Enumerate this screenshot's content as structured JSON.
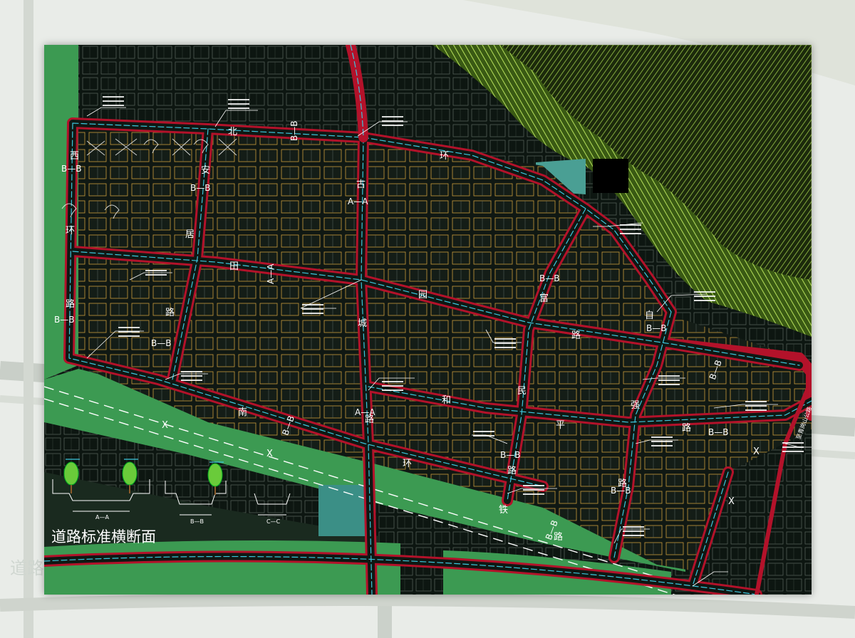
{
  "map": {
    "title": "道路标准横断面",
    "ghost_title": "道路",
    "side_road_label": "至青岗山公路",
    "x_marks": [
      "X",
      "X",
      "X",
      "X"
    ],
    "roads": [
      {
        "id": "ring-north-1",
        "text": "北"
      },
      {
        "id": "ring-north-2",
        "text": "环"
      },
      {
        "id": "ring-west-1",
        "text": "西"
      },
      {
        "id": "ring-west-2",
        "text": "环"
      },
      {
        "id": "ring-west-3",
        "text": "路"
      },
      {
        "id": "anju-1",
        "text": "安"
      },
      {
        "id": "anju-2",
        "text": "居"
      },
      {
        "id": "anju-3",
        "text": "路"
      },
      {
        "id": "gucheng-1",
        "text": "古"
      },
      {
        "id": "gucheng-2",
        "text": "城"
      },
      {
        "id": "gucheng-3",
        "text": "路"
      },
      {
        "id": "tianyuan-1",
        "text": "田"
      },
      {
        "id": "tianyuan-2",
        "text": "园"
      },
      {
        "id": "tianyuan-3",
        "text": "路"
      },
      {
        "id": "fuming-1",
        "text": "富"
      },
      {
        "id": "fuming-2",
        "text": "民"
      },
      {
        "id": "fuming-3",
        "text": "路"
      },
      {
        "id": "ziqiang-1",
        "text": "自"
      },
      {
        "id": "ziqiang-2",
        "text": "强"
      },
      {
        "id": "ziqiang-3",
        "text": "路"
      },
      {
        "id": "ring-south-1",
        "text": "南"
      },
      {
        "id": "ring-south-2",
        "text": "环"
      },
      {
        "id": "railway-1",
        "text": "铁"
      },
      {
        "id": "railway-2",
        "text": "路"
      },
      {
        "id": "heping-1",
        "text": "和"
      },
      {
        "id": "heping-2",
        "text": "平"
      },
      {
        "id": "heping-3",
        "text": "路"
      }
    ],
    "section_marks": [
      "A—A",
      "A—A",
      "A—A",
      "B—B",
      "B—B",
      "B—B",
      "B—B",
      "B—B",
      "B—B",
      "B—B",
      "B—B",
      "B—B",
      "B—B",
      "B—B",
      "B—B",
      "B—B"
    ],
    "cross_sections": [
      {
        "id": "a",
        "label": "A—A"
      },
      {
        "id": "b",
        "label": "B—B"
      },
      {
        "id": "c",
        "label": "C—C"
      }
    ]
  }
}
